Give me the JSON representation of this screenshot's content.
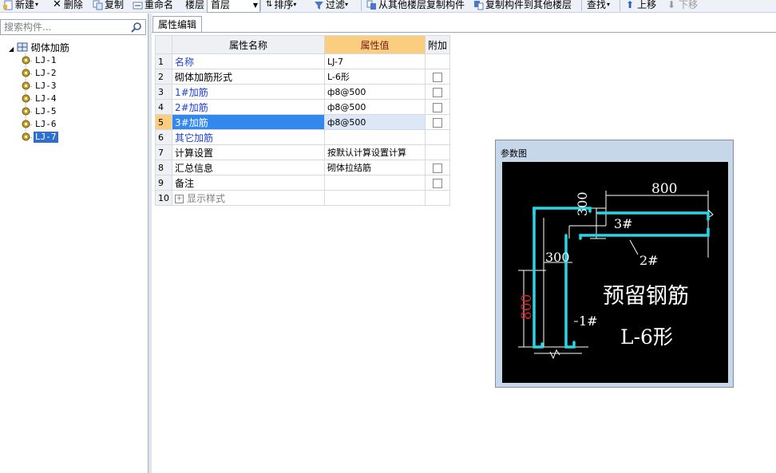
{
  "toolbar": {
    "new_label": "新建",
    "delete_label": "删除",
    "copy_label": "复制",
    "rename_label": "重命名",
    "floor_label": "楼层",
    "floor_value": "首层",
    "sort_label": "排序",
    "filter_label": "过滤",
    "copy_from_label": "从其他楼层复制构件",
    "copy_to_label": "复制构件到其他楼层",
    "find_label": "查找",
    "up_label": "上移",
    "down_label": "下移"
  },
  "left_panel": {
    "search_placeholder": "搜索构件...",
    "tree_root": "砌体加筋",
    "items": [
      "LJ-1",
      "LJ-2",
      "LJ-3",
      "LJ-4",
      "LJ-5",
      "LJ-6",
      "LJ-7"
    ],
    "selected_index": 6
  },
  "tab": {
    "label": "属性编辑"
  },
  "grid": {
    "headers": {
      "name": "属性名称",
      "value": "属性值",
      "extra": "附加"
    },
    "rows": [
      {
        "num": "1",
        "name": "名称",
        "value": "LJ-7",
        "checkbox": false,
        "color": "blue"
      },
      {
        "num": "2",
        "name": "砌体加筋形式",
        "value": "L-6形",
        "checkbox": true,
        "color": "black"
      },
      {
        "num": "3",
        "name": "1#加筋",
        "value": "ф8@500",
        "checkbox": true,
        "color": "blue"
      },
      {
        "num": "4",
        "name": "2#加筋",
        "value": "ф8@500",
        "checkbox": true,
        "color": "blue"
      },
      {
        "num": "5",
        "name": "3#加筋",
        "value": "ф8@500",
        "checkbox": true,
        "color": "blue",
        "selected": true
      },
      {
        "num": "6",
        "name": "其它加筋",
        "value": "",
        "checkbox": false,
        "color": "blue"
      },
      {
        "num": "7",
        "name": "计算设置",
        "value": "按默认计算设置计算",
        "checkbox": false,
        "color": "black"
      },
      {
        "num": "8",
        "name": "汇总信息",
        "value": "砌体拉结筋",
        "checkbox": true,
        "color": "black"
      },
      {
        "num": "9",
        "name": "备注",
        "value": "",
        "checkbox": true,
        "color": "black"
      },
      {
        "num": "10",
        "name": "显示样式",
        "value": "",
        "checkbox": false,
        "color": "gray",
        "expandable": true
      }
    ]
  },
  "diagram": {
    "title": "参数图",
    "dim_top": "800",
    "dim_vertical_small": "300",
    "dim_horizontal_small": "300",
    "dim_left": "800",
    "label_1": "1#",
    "label_2": "2#",
    "label_3": "3#",
    "caption_1": "预留钢筋",
    "caption_2": "L-6形"
  }
}
